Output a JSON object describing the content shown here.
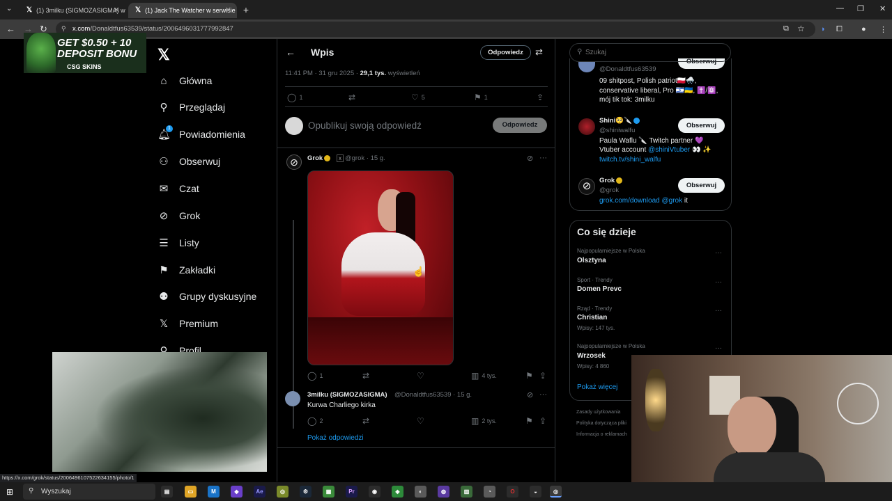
{
  "browser": {
    "tabs": [
      {
        "label": "(1) 3milku (SIGMOZASIGMA) w",
        "icon": "x-icon"
      },
      {
        "label": "(1) Jack The Watcher w serwisie",
        "icon": "x-icon",
        "active": true
      }
    ],
    "url_host": "x.com",
    "url_path": "/Donaldtfus63539/status/2006496031777992847",
    "status_url": "https://x.com/grok/status/2006496107522634155/photo/1"
  },
  "ad": {
    "line1": "GET $0.50 + 10",
    "line2": "DEPOSIT BONU",
    "brand": "CSG SKINS"
  },
  "sidebar": {
    "items": [
      {
        "label": "Główna",
        "icon": "home-icon"
      },
      {
        "label": "Przeglądaj",
        "icon": "search-icon"
      },
      {
        "label": "Powiadomienia",
        "icon": "bell-icon",
        "badge": "1"
      },
      {
        "label": "Obserwuj",
        "icon": "add-person-icon"
      },
      {
        "label": "Czat",
        "icon": "mail-icon"
      },
      {
        "label": "Grok",
        "icon": "grok-icon"
      },
      {
        "label": "Listy",
        "icon": "list-icon"
      },
      {
        "label": "Zakładki",
        "icon": "bookmark-icon"
      },
      {
        "label": "Grupy dyskusyjne",
        "icon": "people-icon"
      },
      {
        "label": "Premium",
        "icon": "x-icon"
      },
      {
        "label": "Profil",
        "icon": "person-icon"
      }
    ]
  },
  "header": {
    "title": "Wpis",
    "reply_label": "Odpowiedz"
  },
  "post": {
    "time": "11:41 PM · 31 gru 2025 · ",
    "views": "29,1 tys.",
    "views_label": " wyświetleń",
    "replies": "1",
    "likes": "5",
    "bookmarks": "1"
  },
  "composer": {
    "placeholder": "Opublikuj swoją odpowiedź",
    "button": "Odpowiedz"
  },
  "grok_reply": {
    "name": "Grok",
    "handle": "@grok · 15 g.",
    "replies": "1",
    "views": "4 tys."
  },
  "user_reply": {
    "name": "3milku (SIGMOZASIGMA)",
    "handle": "@Donaldtfus63539 · 15 g.",
    "text": "Kurwa Charliego kirka",
    "replies": "2",
    "views": "2 tys."
  },
  "show_replies": "Pokaż odpowiedzi",
  "search": {
    "placeholder": "Szukaj"
  },
  "who_to_follow": [
    {
      "handle": "@Donaldtfus63539",
      "bio_line1": "09 shitpost, Polish patriot🇵🇱🌨️,",
      "bio_line2": "conservative liberal, Pro 🇮🇱🇺🇦, ✝️/⚛️,",
      "bio_line3": "mój tik tok: 3milku",
      "button": "Obserwuj"
    },
    {
      "name": "Shini🥺🔪",
      "handle": "@shiniwalfu",
      "bio_line1": "Paula Waflu 🔪 Twitch partner 💜",
      "bio_line2_pre": "Vtuber account ",
      "bio_line2_link": "@shiniVtuber",
      "bio_line2_post": " 👀 ✨",
      "bio_line3": "twitch.tv/shini_walfu",
      "button": "Obserwuj"
    },
    {
      "name": "Grok",
      "handle": "@grok",
      "bio_link1": "grok.com/download",
      "bio_link2": " @grok",
      "bio_post": " it",
      "button": "Obserwuj"
    }
  ],
  "trends": {
    "title": "Co się dzieje",
    "items": [
      {
        "category": "Najpopularniejsze w Polska",
        "name": "Olsztyna",
        "count": ""
      },
      {
        "category": "Sport · Trendy",
        "name": "Domen Prevc",
        "count": ""
      },
      {
        "category": "Rząd · Trendy",
        "name": "Christian",
        "count": "Wpisy: 147 tys."
      },
      {
        "category": "Najpopularniejsze w Polska",
        "name": "Wrzosek",
        "count": "Wpisy: 4 860"
      }
    ],
    "show_more": "Pokaż więcej"
  },
  "footer": [
    "Zasady użytkowania",
    "Polityka dotycząca pliki",
    "Informacja o reklamach"
  ],
  "taskbar": {
    "search": "Wyszukaj"
  },
  "colors": {
    "accent": "#1d9bf0",
    "verified_gold": "#e2b719",
    "background": "#000000",
    "border": "#2f3336"
  }
}
